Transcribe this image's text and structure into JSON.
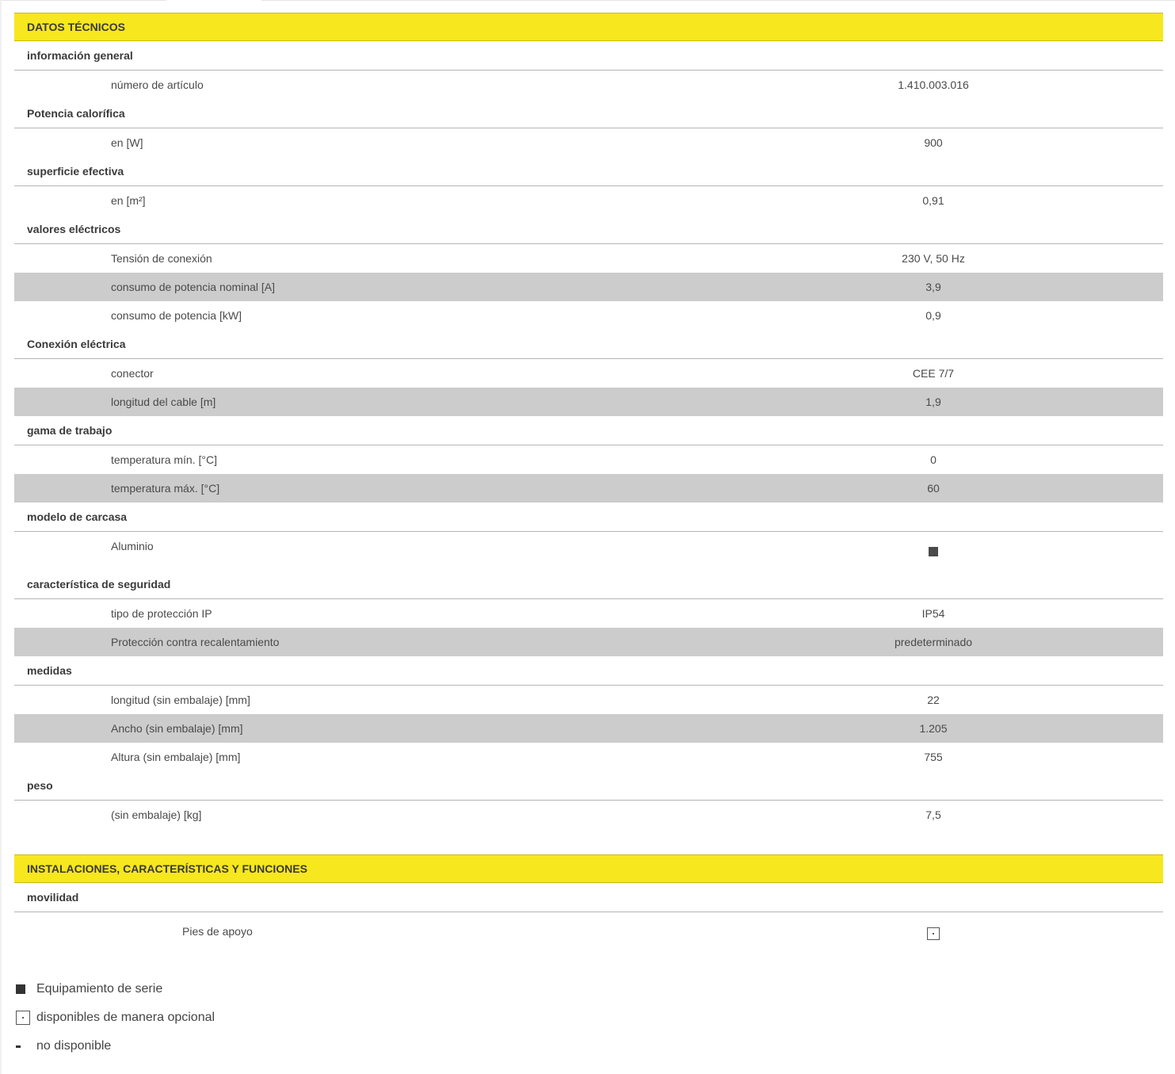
{
  "tech_data": {
    "header": "DATOS TÉCNICOS",
    "sections": [
      {
        "title": "información general",
        "rows": [
          {
            "label": "número de artículo",
            "value": "1.410.003.016"
          }
        ]
      },
      {
        "title": "Potencia calorífica",
        "rows": [
          {
            "label": "en [W]",
            "value": "900"
          }
        ]
      },
      {
        "title": "superficie efectiva",
        "rows": [
          {
            "label": "en [m²]",
            "value": "0,91"
          }
        ]
      },
      {
        "title": "valores eléctricos",
        "rows": [
          {
            "label": "Tensión de conexión",
            "value": "230 V, 50 Hz"
          },
          {
            "label": "consumo de potencia nominal [A]",
            "value": "3,9"
          },
          {
            "label": "consumo de potencia [kW]",
            "value": "0,9"
          }
        ]
      },
      {
        "title": "Conexión eléctrica",
        "rows": [
          {
            "label": "conector",
            "value": "CEE 7/7"
          },
          {
            "label": "longitud del cable [m]",
            "value": "1,9"
          }
        ]
      },
      {
        "title": "gama de trabajo",
        "rows": [
          {
            "label": "temperatura mín. [°C]",
            "value": "0"
          },
          {
            "label": "temperatura máx. [°C]",
            "value": "60"
          }
        ]
      },
      {
        "title": "modelo de carcasa",
        "rows": [
          {
            "label": "Aluminio",
            "icon": "standard-square-icon"
          }
        ]
      },
      {
        "title": "característica de seguridad",
        "rows": [
          {
            "label": "tipo de protección IP",
            "value": "IP54"
          },
          {
            "label": "Protección contra recalentamiento",
            "value": "predeterminado"
          }
        ]
      },
      {
        "title": "medidas",
        "rows": [
          {
            "label": "longitud (sin embalaje) [mm]",
            "value": "22"
          },
          {
            "label": "Ancho (sin embalaje) [mm]",
            "value": "1.205"
          },
          {
            "label": "Altura (sin embalaje) [mm]",
            "value": "755"
          }
        ]
      },
      {
        "title": "peso",
        "rows": [
          {
            "label": "(sin embalaje) [kg]",
            "value": "7,5"
          }
        ]
      }
    ]
  },
  "features": {
    "header": "INSTALACIONES, CARACTERÍSTICAS Y FUNCIONES",
    "sections": [
      {
        "title": "movilidad",
        "rows": [
          {
            "label": "Pies de apoyo",
            "icon": "optional-square-icon"
          }
        ]
      }
    ]
  },
  "legend": [
    {
      "icon": "standard-square-icon",
      "text": "Equipamiento de serie"
    },
    {
      "icon": "optional-square-icon",
      "text": "disponibles de manera opcional"
    },
    {
      "icon": "dash-icon",
      "text": "no disponible"
    }
  ],
  "colors": {
    "header_bg": "#f7e71e",
    "alt_row_bg": "#cccccc"
  }
}
